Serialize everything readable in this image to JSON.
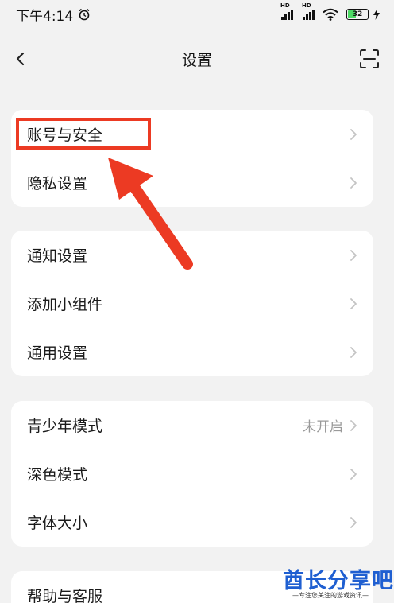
{
  "status_bar": {
    "time": "下午4:14",
    "signal1_tag": "HD",
    "signal2_tag": "HD",
    "battery": "32"
  },
  "header": {
    "title": "设置"
  },
  "groups": [
    {
      "items": [
        {
          "label": "账号与安全"
        },
        {
          "label": "隐私设置"
        }
      ]
    },
    {
      "items": [
        {
          "label": "通知设置"
        },
        {
          "label": "添加小组件"
        },
        {
          "label": "通用设置"
        }
      ]
    },
    {
      "items": [
        {
          "label": "青少年模式",
          "value": "未开启"
        },
        {
          "label": "深色模式"
        },
        {
          "label": "字体大小"
        }
      ]
    },
    {
      "items": [
        {
          "label": "帮助与客服"
        }
      ]
    }
  ],
  "annotation": {
    "color": "#ec3a23",
    "highlighted_item": "账号与安全"
  },
  "watermark": {
    "main": "酋长分享吧",
    "sub": "—专注您关注的游戏资讯—"
  },
  "colors": {
    "background": "#f2f2f2",
    "card": "#ffffff",
    "accent": "#ec3a23",
    "watermark": "#1f5fd1"
  }
}
